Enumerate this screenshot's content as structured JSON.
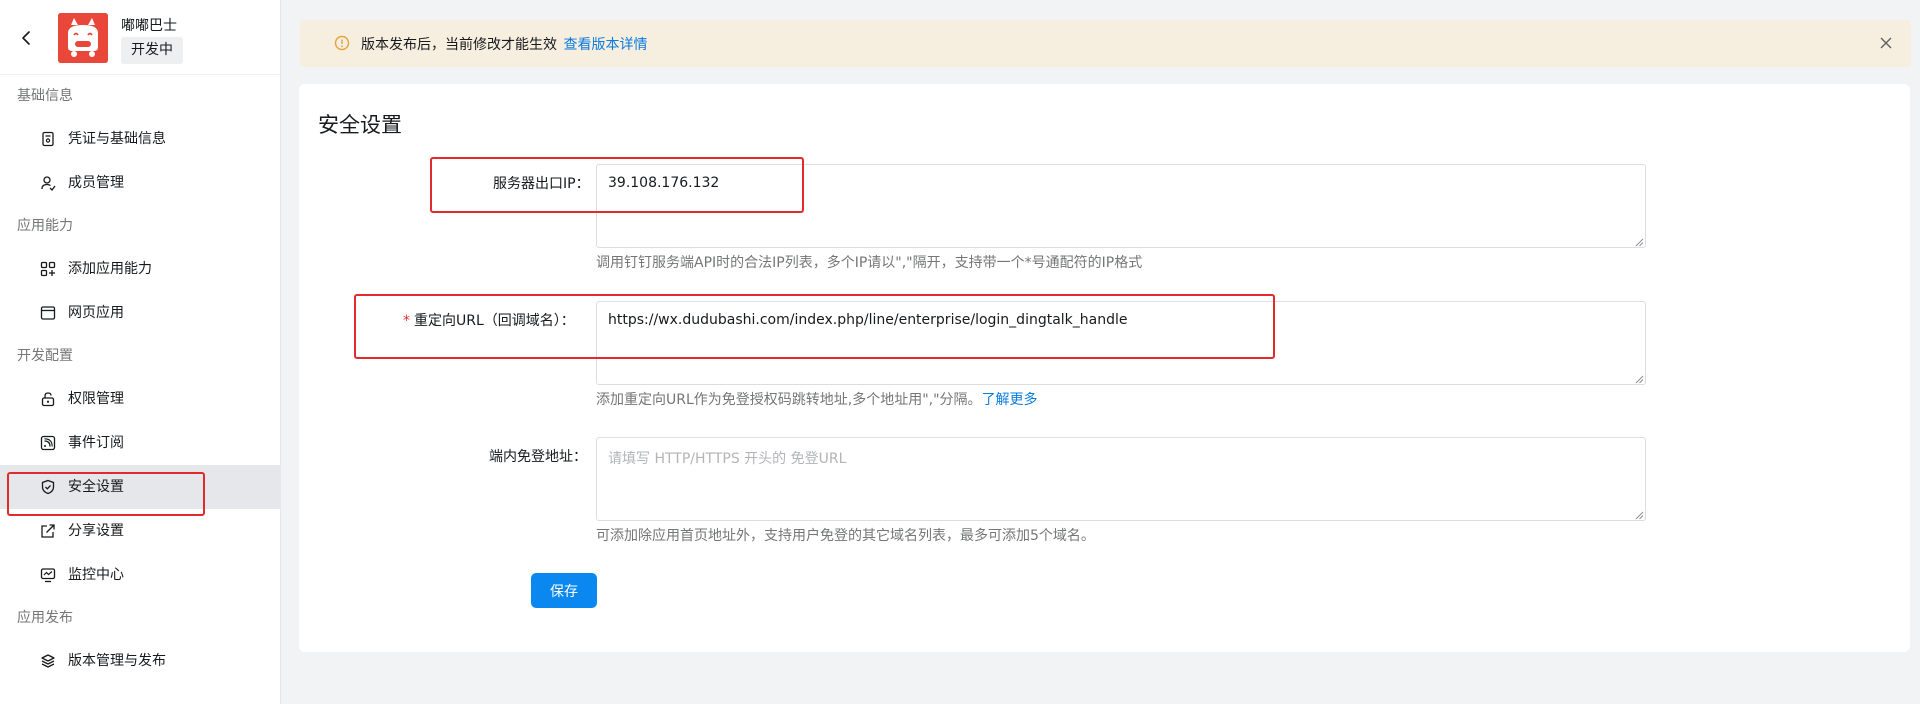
{
  "app": {
    "name": "嘟嘟巴士",
    "status": "开发中"
  },
  "sidebar": {
    "groups": [
      {
        "title": "基础信息",
        "items": [
          {
            "label": "凭证与基础信息",
            "icon": "credential-icon"
          },
          {
            "label": "成员管理",
            "icon": "member-icon"
          }
        ]
      },
      {
        "title": "应用能力",
        "items": [
          {
            "label": "添加应用能力",
            "icon": "add-capability-icon"
          },
          {
            "label": "网页应用",
            "icon": "webpage-icon"
          }
        ]
      },
      {
        "title": "开发配置",
        "items": [
          {
            "label": "权限管理",
            "icon": "lock-icon"
          },
          {
            "label": "事件订阅",
            "icon": "rss-icon"
          },
          {
            "label": "安全设置",
            "icon": "shield-icon",
            "active": true
          },
          {
            "label": "分享设置",
            "icon": "share-icon"
          },
          {
            "label": "监控中心",
            "icon": "monitor-icon"
          }
        ]
      },
      {
        "title": "应用发布",
        "items": [
          {
            "label": "版本管理与发布",
            "icon": "layers-icon"
          }
        ]
      }
    ]
  },
  "notice": {
    "text": "版本发布后，当前修改才能生效",
    "link": "查看版本详情"
  },
  "page": {
    "title": "安全设置"
  },
  "form": {
    "server_ip": {
      "label": "服务器出口IP：",
      "value": "39.108.176.132",
      "help": "调用钉钉服务端API时的合法IP列表，多个IP请以\",\"隔开，支持带一个*号通配符的IP格式"
    },
    "redirect_url": {
      "required_mark": "*",
      "label": "重定向URL（回调域名）：",
      "value": "https://wx.dudubashi.com/index.php/line/enterprise/login_dingtalk_handle",
      "help": "添加重定向URL作为免登授权码跳转地址,多个地址用\",\"分隔。",
      "help_link": "了解更多"
    },
    "login_free_url": {
      "label": "端内免登地址：",
      "placeholder": "请填写 HTTP/HTTPS 开头的 免登URL",
      "value": "",
      "help": "可添加除应用首页地址外，支持用户免登的其它域名列表，最多可添加5个域名。"
    },
    "save_label": "保存"
  },
  "colors": {
    "accent": "#0b88ef",
    "link": "#0b7be0",
    "notice_bg": "#f6eedf",
    "warning": "#e6a23c",
    "annotation": "#e12a2a",
    "logo_bg": "#e8473a"
  }
}
